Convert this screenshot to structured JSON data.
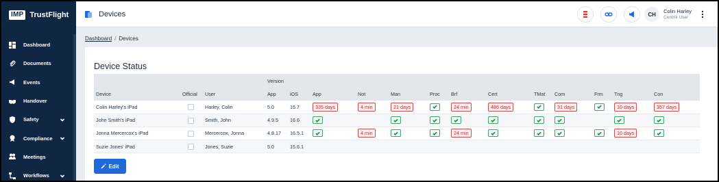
{
  "brand": {
    "logo": "IMP",
    "name": "TrustFlight"
  },
  "sidebar": {
    "items": [
      {
        "label": "Dashboard",
        "icon": "dashboard-icon",
        "chevron": false
      },
      {
        "label": "Documents",
        "icon": "paperclip-icon",
        "chevron": false
      },
      {
        "label": "Events",
        "icon": "megaphone-icon",
        "chevron": false
      },
      {
        "label": "Handover",
        "icon": "handshake-icon",
        "chevron": false
      },
      {
        "label": "Safety",
        "icon": "shield-icon",
        "chevron": true
      },
      {
        "label": "Compliance",
        "icon": "badge-icon",
        "chevron": true
      },
      {
        "label": "Meetings",
        "icon": "users-icon",
        "chevron": false
      },
      {
        "label": "Workflows",
        "icon": "flow-icon",
        "chevron": true
      }
    ]
  },
  "header": {
    "title": "Devices",
    "user": {
      "initials": "CH",
      "name": "Colin Harley",
      "role": "Centrik User"
    }
  },
  "breadcrumb": {
    "parent": "Dashboard",
    "separator": "/",
    "current": "Devices"
  },
  "card": {
    "title": "Device Status",
    "edit_label": "Edit"
  },
  "table": {
    "group_header": "Version",
    "columns": [
      "Device",
      "Official",
      "User",
      "App",
      "iOS",
      "App",
      "Not",
      "Man",
      "Proc",
      "Brf",
      "Cert",
      "TMat",
      "Com",
      "Frm",
      "Tng",
      "Con"
    ],
    "rows": [
      {
        "device": "Colin Harley's iPad",
        "user": "Harley, Colin",
        "app": "5.0",
        "ios": "15.7",
        "status": [
          "335 days",
          "4 min",
          "21 days",
          "ok",
          "24 min",
          "486 days",
          "ok",
          "31 days",
          "ok",
          "10 days",
          "357 days"
        ]
      },
      {
        "device": "John Smith's iPad",
        "user": "Smith, John",
        "app": "4.9.5",
        "ios": "16.6",
        "status": [
          "ok",
          "",
          "ok",
          "ok",
          "ok",
          "ok",
          "ok",
          "ok",
          "",
          "ok",
          "ok"
        ]
      },
      {
        "device": "Jonna Mercercox's iPad",
        "user": "Mercercox, Jonna",
        "app": "4.8.17",
        "ios": "16.5.1",
        "status": [
          "ok",
          "4 min",
          "ok",
          "ok",
          "24 min",
          "ok",
          "ok",
          "ok",
          "ok",
          "10 days",
          "ok"
        ]
      },
      {
        "device": "Suzie Jones' iPad",
        "user": "Jones, Suzie",
        "app": "5.0",
        "ios": "15.6.1",
        "status": [
          "",
          "",
          "",
          "",
          "",
          "",
          "",
          "",
          "",
          "",
          ""
        ]
      }
    ]
  },
  "colors": {
    "sidebar": "#0f2742",
    "accent": "#1f6ad8",
    "ok": "#3ea56a",
    "warn": "#d94949"
  }
}
